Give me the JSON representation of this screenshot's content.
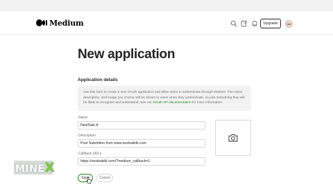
{
  "header": {
    "brand": "Medium",
    "upgrade_label": "Upgrade",
    "icons": [
      "search-icon",
      "write-icon",
      "notifications-icon"
    ]
  },
  "main": {
    "title": "New application",
    "section_title": "Application details",
    "info": {
      "text": "Use this form to create a new OAuth application and allow users to authenticate through Medium. The name, description, and image you choose will be shown to users when they authenticate, so pick something they will be likely to recognize and understand. See our ",
      "link": "OAuth API documentation",
      "suffix": " for more information."
    },
    "fields": {
      "name_label": "Name",
      "name_value": "NestSale.K",
      "description_label": "Description",
      "description_value": "Post Submition from www.nestsalelk.com",
      "callback_label": "Callback URLs",
      "callback_value": "https://nestsalelk.com/?medium_callback=1"
    },
    "image_icon": "camera-icon",
    "buttons": {
      "save_label": "Save",
      "cancel_label": "Cancel"
    }
  },
  "watermark": {
    "text": "MINE",
    "accent": "X",
    "accent_color": "#7ac943"
  },
  "colors": {
    "brand_green": "#1a8917",
    "text_primary": "#242424",
    "text_secondary": "#6b6b6b",
    "info_bg": "#f2f2f2"
  }
}
